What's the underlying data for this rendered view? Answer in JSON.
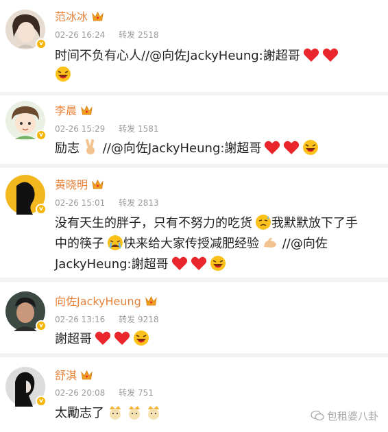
{
  "comments": [
    {
      "name": "范冰冰",
      "time": "02-26 16:24",
      "repost_label": "转发",
      "repost_count": "2518",
      "text": "时间不负有心人//@向佐JackyHeung:謝超哥"
    },
    {
      "name": "李晨",
      "time": "02-26 15:29",
      "repost_label": "转发",
      "repost_count": "1581",
      "text_a": "励志",
      "text_b": " //@向佐JackyHeung:謝超哥"
    },
    {
      "name": "黄晓明",
      "time": "02-26 15:01",
      "repost_label": "转发",
      "repost_count": "2813",
      "text_a": "没有天生的胖子，只有不努力的吃货",
      "text_b": "我默默放下了手中的筷子",
      "text_c": "快来给大家传授减肥经验",
      "text_d": " //@向佐JackyHeung:謝超哥"
    },
    {
      "name": "向佐JackyHeung",
      "time": "02-26 13:16",
      "repost_label": "转发",
      "repost_count": "9218",
      "text": "謝超哥"
    },
    {
      "name": "舒淇",
      "time": "02-26 20:08",
      "repost_label": "转发",
      "repost_count": "751",
      "text": "太勵志了"
    }
  ],
  "watermark": "包租婆八卦",
  "colors": {
    "name": "#e8833a",
    "meta": "#9a9a9a",
    "heart": "#e8262b",
    "badge": "#f5b400"
  }
}
